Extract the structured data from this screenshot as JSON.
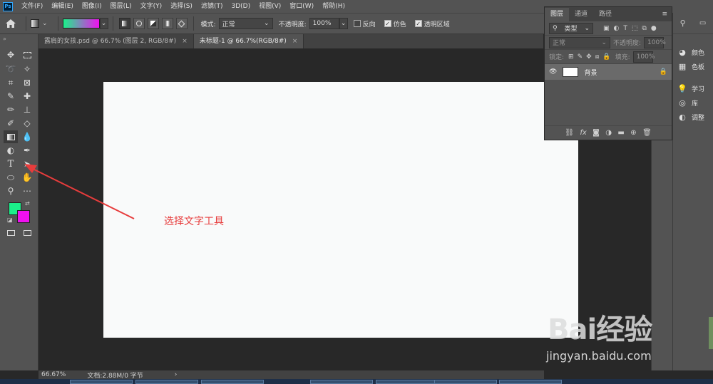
{
  "menubar": {
    "logo": "Ps",
    "items": [
      "文件(F)",
      "编辑(E)",
      "图像(I)",
      "图层(L)",
      "文字(Y)",
      "选择(S)",
      "滤镜(T)",
      "3D(D)",
      "视图(V)",
      "窗口(W)",
      "帮助(H)"
    ]
  },
  "options": {
    "mode_label": "模式:",
    "mode_value": "正常",
    "opacity_label": "不透明度:",
    "opacity_value": "100%",
    "reverse_label": "反向",
    "dither_label": "仿色",
    "transparency_label": "透明区域",
    "gradient_colors": [
      "#1bf28a",
      "#f010f0"
    ]
  },
  "tabs": [
    {
      "label": "露肩的女孩.psd @ 66.7% (图层 2, RGB/8#)",
      "close": "×"
    },
    {
      "label": "未标题-1 @ 66.7%(RGB/8#)",
      "close": "×"
    }
  ],
  "toolbar": {
    "foreground_color": "#1bef8a",
    "background_color": "#f010f0"
  },
  "annotation": {
    "text": "选择文字工具",
    "color": "#e73c3c"
  },
  "layers_panel": {
    "tabs": [
      "图层",
      "通道",
      "路径"
    ],
    "kind_label": "类型",
    "blend_mode": "正常",
    "opacity_label": "不透明度:",
    "opacity_value": "100%",
    "lock_label": "锁定:",
    "fill_label": "填充:",
    "fill_value": "100%",
    "layer_name": "背景"
  },
  "right_panels": [
    {
      "label": "颜色",
      "icon": "color-icon"
    },
    {
      "label": "色板",
      "icon": "swatches-icon"
    },
    {
      "label": "学习",
      "icon": "learn-icon"
    },
    {
      "label": "库",
      "icon": "libraries-icon"
    },
    {
      "label": "调整",
      "icon": "adjustments-icon"
    }
  ],
  "statusbar": {
    "zoom": "66.67%",
    "doc_info": "文档:2.88M/0 字节",
    "arrow": "›"
  },
  "watermark": {
    "logo": "Bai经验",
    "url": "jingyan.baidu.com"
  }
}
